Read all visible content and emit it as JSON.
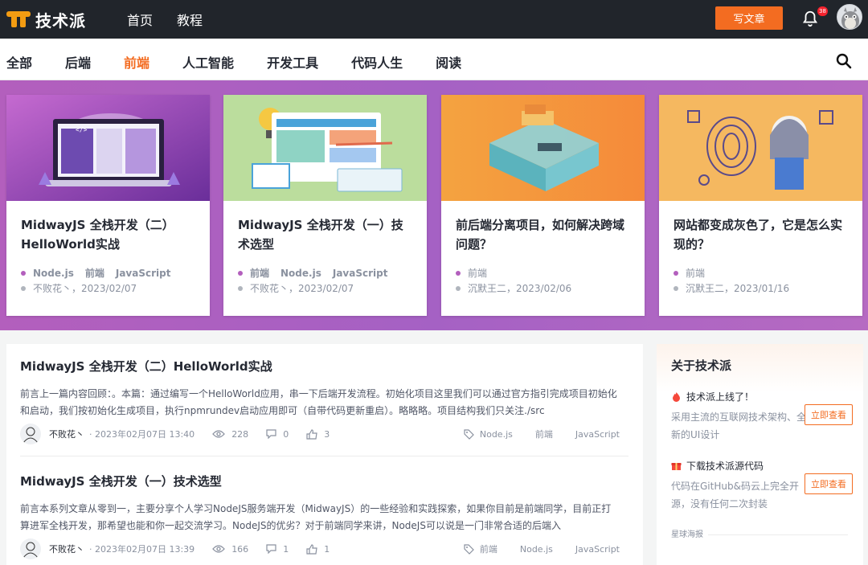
{
  "brand": {
    "name": "技术派"
  },
  "topnav": [
    {
      "label": "首页"
    },
    {
      "label": "教程"
    }
  ],
  "header": {
    "write_label": "写文章",
    "notify_count": "38"
  },
  "categories": [
    {
      "label": "全部"
    },
    {
      "label": "后端"
    },
    {
      "label": "前端"
    },
    {
      "label": "人工智能"
    },
    {
      "label": "开发工具"
    },
    {
      "label": "代码人生"
    },
    {
      "label": "阅读"
    }
  ],
  "active_category": "前端",
  "cards": [
    {
      "title": "MidwayJS 全栈开发（二）HelloWorld实战",
      "tags": [
        "Node.js",
        "前端",
        "JavaScript"
      ],
      "author_date": "不败花丶，2023/02/07"
    },
    {
      "title": "MidwayJS 全栈开发（一）技术选型",
      "tags": [
        "前端",
        "Node.js",
        "JavaScript"
      ],
      "author_date": "不败花丶，2023/02/07"
    },
    {
      "title": "前后端分离项目，如何解决跨域问题？",
      "tags": [
        "前端"
      ],
      "author_date": "沉默王二，2023/02/06"
    },
    {
      "title": "网站都变成灰色了，它是怎么实现的？",
      "tags": [
        "前端"
      ],
      "author_date": "沉默王二，2023/01/16"
    }
  ],
  "articles": [
    {
      "title": "MidwayJS 全栈开发（二）HelloWorld实战",
      "summary": "前言上一篇内容回顾：。本篇：通过编写一个HelloWorld应用，串一下后端开发流程。初始化项目这里我们可以通过官方指引完成项目初始化和启动，我们按初始化生成项目，执行npmrundev启动应用即可（自带代码更新重启）。略略略。项目结构我们只关注./src",
      "author": "不败花丶",
      "time": "· 2023年02月07日 13:40",
      "views": "228",
      "comments": "0",
      "likes": "3",
      "tags": [
        "Node.js",
        "前端",
        "JavaScript"
      ]
    },
    {
      "title": "MidwayJS 全栈开发（一）技术选型",
      "summary": "前言本系列文章从零到一，主要分享个人学习NodeJS服务端开发（MidwayJS）的一些经验和实践探索，如果你目前是前端同学，目前正打算进军全栈开发，那希望也能和你一起交流学习。NodeJS的优劣？对于前端同学来讲，NodeJS可以说是一门非常合适的后端入",
      "author": "不败花丶",
      "time": "· 2023年02月07日 13:39",
      "views": "166",
      "comments": "1",
      "likes": "1",
      "tags": [
        "前端",
        "Node.js",
        "JavaScript"
      ]
    }
  ],
  "sidebar": {
    "title": "关于技术派",
    "items": [
      {
        "head": "技术派上线了！",
        "desc": "采用主流的互联网技术架构、全新的UI设计",
        "button": "立即查看",
        "icon": "fire-icon"
      },
      {
        "head": "下载技术派源代码",
        "desc": "代码在GitHub&码云上完全开源，没有任何二次封装",
        "button": "立即查看",
        "icon": "gift-icon"
      }
    ],
    "poster_label": "星球海报"
  },
  "colors": {
    "accent": "#f36c21",
    "banner": "#b35fbd",
    "topbar": "#21252b"
  }
}
